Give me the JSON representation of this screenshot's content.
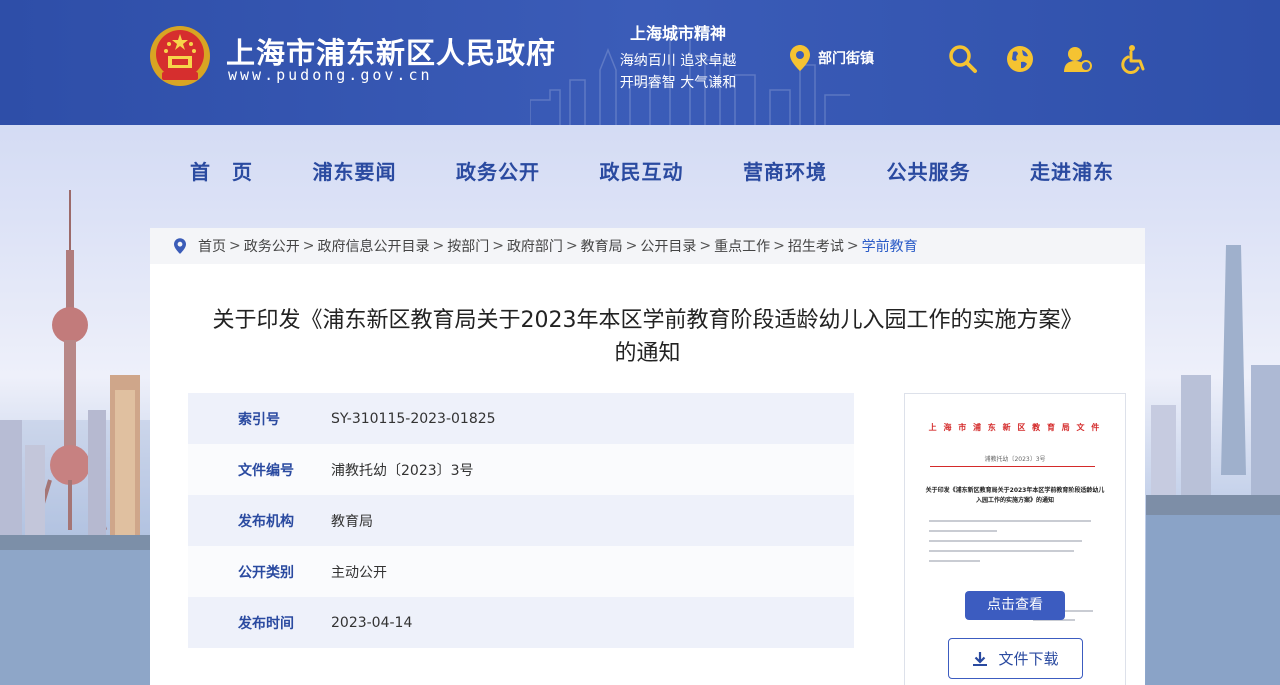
{
  "header": {
    "site_title": "上海市浦东新区人民政府",
    "site_url": "www.pudong.gov.cn",
    "spirit_title": "上海城市精神",
    "spirit_lines": [
      "海纳百川  追求卓越",
      "开明睿智  大气谦和"
    ],
    "dept_link": "部门街镇",
    "icons": [
      "location-pin-icon",
      "search-icon",
      "globe-icon",
      "user-icon",
      "accessibility-icon"
    ],
    "brand_color": "#3b5cb8",
    "accent_color": "#f5c332"
  },
  "nav": {
    "items": [
      "首　页",
      "浦东要闻",
      "政务公开",
      "政民互动",
      "营商环境",
      "公共服务",
      "走进浦东"
    ]
  },
  "breadcrumb": {
    "items": [
      "首页",
      "政务公开",
      "政府信息公开目录",
      "按部门",
      "政府部门",
      "教育局",
      "公开目录",
      "重点工作",
      "招生考试",
      "学前教育"
    ],
    "separator": ">"
  },
  "document": {
    "title_line1": "关于印发《浦东新区教育局关于2023年本区学前教育阶段适龄幼儿入园工作的实施方案》",
    "title_line2": "的通知",
    "meta": [
      {
        "label": "索引号",
        "value": "SY-310115-2023-01825"
      },
      {
        "label": "文件编号",
        "value": "浦教托幼〔2023〕3号"
      },
      {
        "label": "发布机构",
        "value": "教育局"
      },
      {
        "label": "公开类别",
        "value": "主动公开"
      },
      {
        "label": "发布时间",
        "value": "2023-04-14"
      }
    ]
  },
  "preview": {
    "header": "上 海 市 浦 东 新 区 教 育 局 文 件",
    "doc_no": "浦教托幼〔2023〕3号",
    "title": "关于印发《浦东新区教育局关于2023年本区学前教育阶段适龄幼儿入园工作的实施方案》的通知",
    "view_button": "点击查看",
    "download_button": "文件下载"
  }
}
